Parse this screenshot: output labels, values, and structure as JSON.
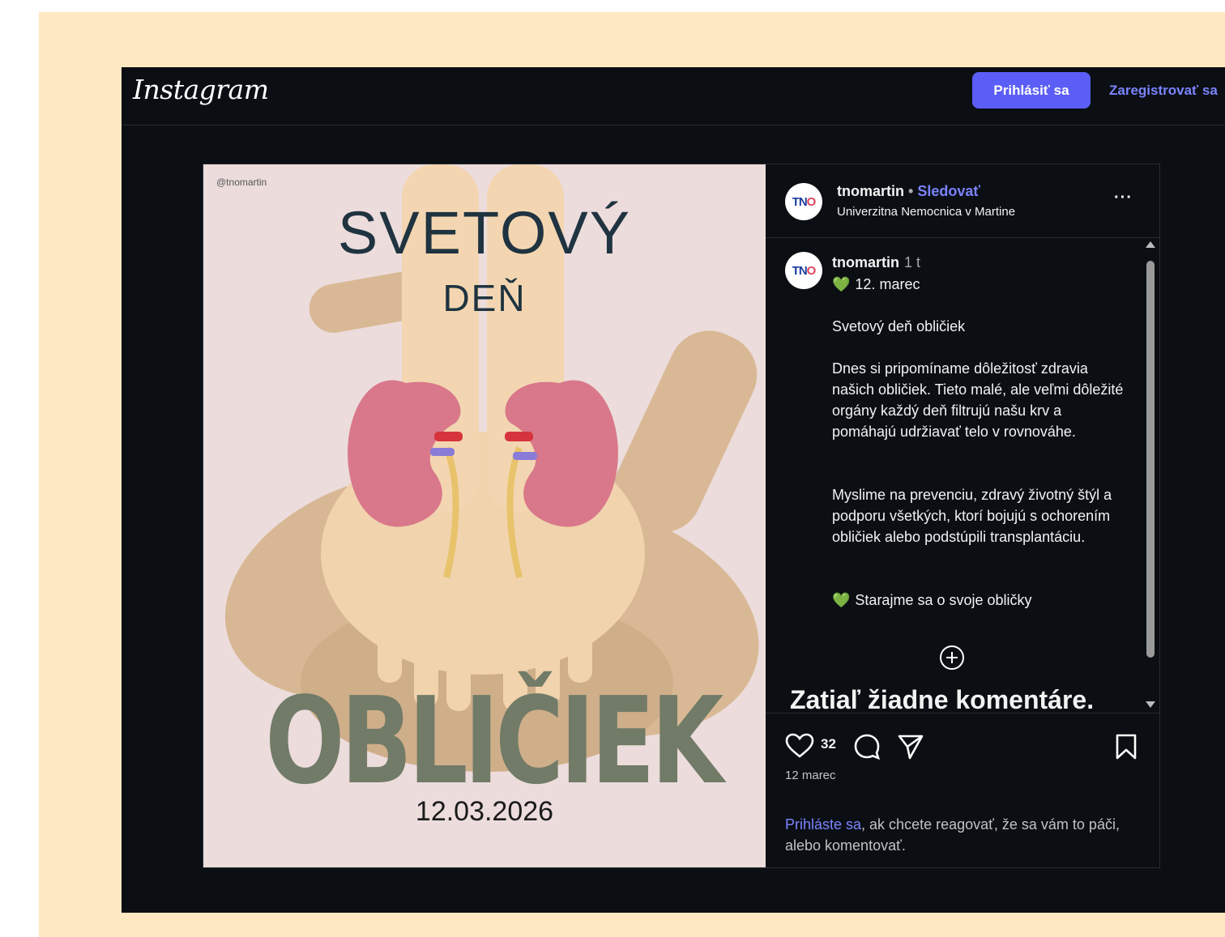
{
  "brand": "Instagram",
  "header": {
    "login_label": "Prihlásiť sa",
    "register_label": "Zaregistrovať sa"
  },
  "media": {
    "handle": "@tnomartin",
    "title_line1": "SVETOVÝ",
    "title_line2": "DEŇ",
    "title_line3": "OBLIČIEK",
    "date": "12.03.2026"
  },
  "post_header": {
    "avatar_text_1": "TN",
    "avatar_text_2": "O",
    "username": "tnomartin",
    "separator": " • ",
    "follow_label": "Sledovať",
    "location": "Univerzitna Nemocnica v Martine",
    "more_label": "···"
  },
  "caption": {
    "username": "tnomartin",
    "time": "1 t",
    "line1": "12. marec",
    "line2": "Svetový deň obličiek",
    "para1": "Dnes si pripomíname dôležitosť zdravia našich obličiek. Tieto malé, ale veľmi dôležité orgány každý deň filtrujú našu krv a pomáhajú udržiavať telo v rovnováhe.",
    "para2": "Myslime na prevenciu, zdravý životný štýl a podporu všetkých, ktorí bojujú s ochorením obličiek alebo podstúpili transplantáciu.",
    "line3": "Starajme sa o svoje obličky",
    "heart_glyph": "💚"
  },
  "comments": {
    "empty_title": "Zatiaľ žiadne komentáre."
  },
  "actions": {
    "like_count": "32",
    "date": "12 marec",
    "login_link": "Prihláste sa",
    "login_text": ", ak chcete reagovať, že sa vám to páči, alebo komentovať."
  },
  "colors": {
    "frame_bg": "#fde8c1",
    "app_bg": "#0b0f14",
    "accent": "#5b5ef6",
    "link": "#7b84ff",
    "media_bg": "#ecdcdc",
    "kidney": "#d9788a",
    "title_green": "#717b67"
  },
  "icons": [
    "heart-icon",
    "comment-icon",
    "share-icon",
    "bookmark-icon",
    "add-comment-icon",
    "more-icon"
  ]
}
